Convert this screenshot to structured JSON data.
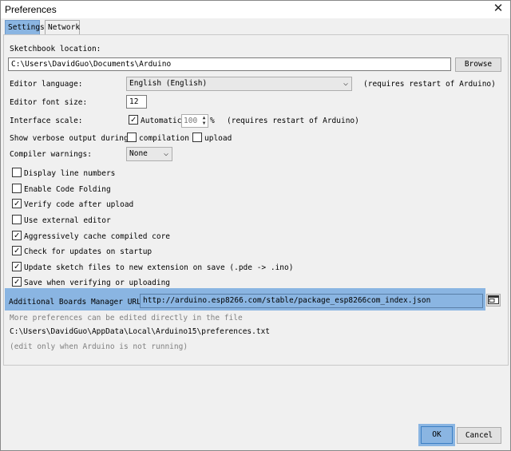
{
  "window": {
    "title": "Preferences"
  },
  "tabs": [
    {
      "label": "Settings"
    },
    {
      "label": "Network"
    }
  ],
  "sketchbook": {
    "label": "Sketchbook location:",
    "value": "C:\\Users\\DavidGuo\\Documents\\Arduino",
    "browse_label": "Browse"
  },
  "editor_language": {
    "label": "Editor language:",
    "value": "English (English)",
    "note": "(requires restart of Arduino)"
  },
  "editor_font_size": {
    "label": "Editor font size:",
    "value": "12"
  },
  "interface_scale": {
    "label": "Interface scale:",
    "automatic_label": "Automatic",
    "automatic_checked": true,
    "value": "100",
    "unit": "%",
    "note": "(requires restart of Arduino)"
  },
  "verbose_output": {
    "label": "Show verbose output during:",
    "compilation_label": "compilation",
    "compilation_checked": false,
    "upload_label": "upload",
    "upload_checked": false
  },
  "compiler_warnings": {
    "label": "Compiler warnings:",
    "value": "None"
  },
  "options": [
    {
      "label": "Display line numbers",
      "checked": false
    },
    {
      "label": "Enable Code Folding",
      "checked": false
    },
    {
      "label": "Verify code after upload",
      "checked": true
    },
    {
      "label": "Use external editor",
      "checked": false
    },
    {
      "label": "Aggressively cache compiled core",
      "checked": true
    },
    {
      "label": "Check for updates on startup",
      "checked": true
    },
    {
      "label": "Update sketch files to new extension on save (.pde -> .ino)",
      "checked": true
    },
    {
      "label": "Save when verifying or uploading",
      "checked": true
    }
  ],
  "boards_manager": {
    "label": "Additional Boards Manager URLs:",
    "value": "http://arduino.esp8266.com/stable/package_esp8266com_index.json",
    "window_icon": "window-icon"
  },
  "footer_notes": {
    "more_prefs": "More preferences can be edited directly in the file",
    "prefs_path": "C:\\Users\\DavidGuo\\AppData\\Local\\Arduino15\\preferences.txt",
    "edit_note": "(edit only when Arduino is not running)"
  },
  "buttons": {
    "ok_label": "OK",
    "cancel_label": "Cancel"
  }
}
